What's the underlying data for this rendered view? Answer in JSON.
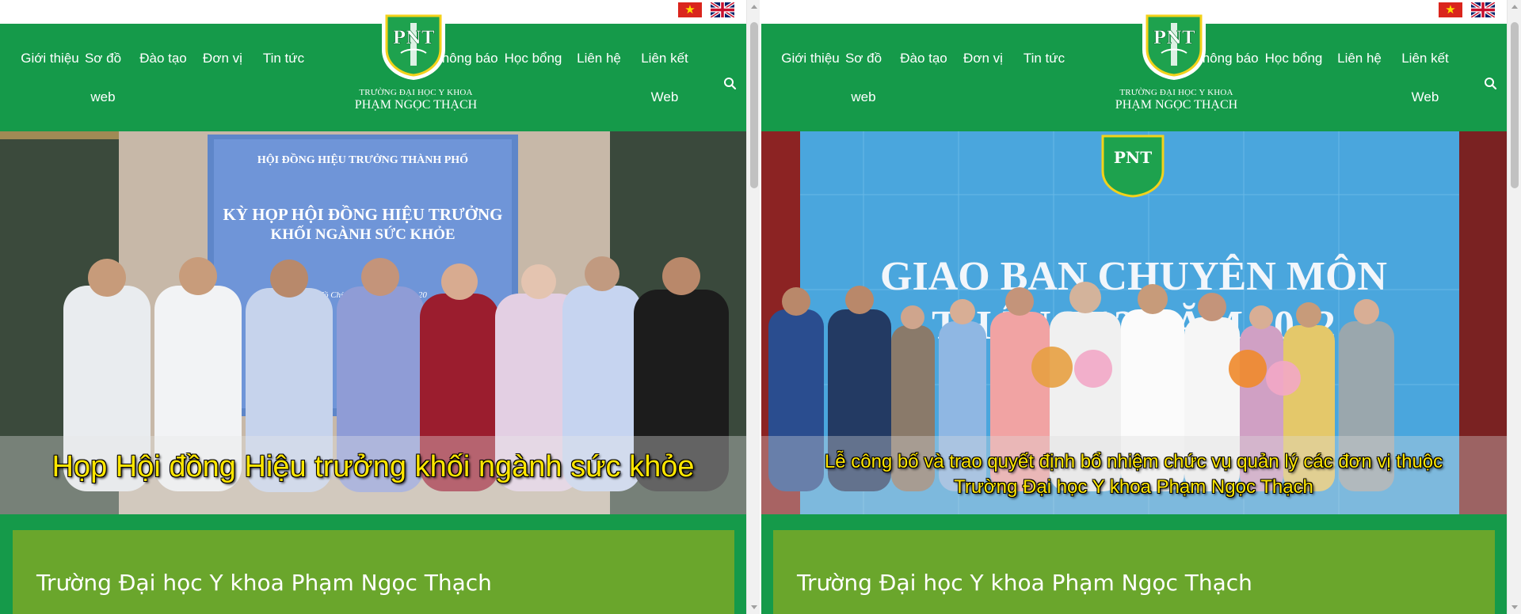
{
  "windows": [
    {
      "nav": {
        "items": [
          {
            "line1": "Giới thiệu",
            "line2": ""
          },
          {
            "line1": "Sơ đồ",
            "line2": "web"
          },
          {
            "line1": "Đào tạo",
            "line2": ""
          },
          {
            "line1": "Đơn vị",
            "line2": ""
          },
          {
            "line1": "Tin tức",
            "line2": ""
          },
          {
            "line1": "Thông báo",
            "line2": ""
          },
          {
            "line1": "Học bổng",
            "line2": ""
          },
          {
            "line1": "Liên hệ",
            "line2": ""
          },
          {
            "line1": "Liên kết",
            "line2": "Web"
          }
        ]
      },
      "logo": {
        "monogram": "PNT",
        "line1": "TRƯỜNG ĐẠI HỌC Y KHOA",
        "line2": "PHẠM NGỌC THẠCH"
      },
      "slide": {
        "screen_title": "HỘI ĐỒNG HIỆU TRƯỞNG THÀNH PHỐ",
        "screen_heading_1": "KỲ HỌP HỘI ĐỒNG HIỆU TRƯỞNG",
        "screen_heading_2": "KHỐI NGÀNH SỨC KHỎE",
        "screen_footer": "Hồ Chí Minh, tháng 12 năm 20",
        "caption_line1": "Họp Hội đồng Hiệu trưởng khối ngành sức khỏe",
        "caption_line2": ""
      },
      "info_title": "Trường Đại học Y khoa Phạm Ngọc Thạch"
    },
    {
      "nav": {
        "items": [
          {
            "line1": "Giới thiệu",
            "line2": ""
          },
          {
            "line1": "Sơ đồ",
            "line2": "web"
          },
          {
            "line1": "Đào tạo",
            "line2": ""
          },
          {
            "line1": "Đơn vị",
            "line2": ""
          },
          {
            "line1": "Tin tức",
            "line2": ""
          },
          {
            "line1": "Thông báo",
            "line2": ""
          },
          {
            "line1": "Học bổng",
            "line2": ""
          },
          {
            "line1": "Liên hệ",
            "line2": ""
          },
          {
            "line1": "Liên kết",
            "line2": "Web"
          }
        ]
      },
      "logo": {
        "monogram": "PNT",
        "line1": "TRƯỜNG ĐẠI HỌC Y KHOA",
        "line2": "PHẠM NGỌC THẠCH"
      },
      "slide": {
        "screen_title": "",
        "screen_heading_1": "GIAO BAN CHUYÊN MÔN",
        "screen_heading_2": "THÁNG 12 NĂM 2022",
        "screen_footer": "",
        "caption_line1": "Lễ công bố và trao quyết định bổ nhiệm chức vụ quản lý các đơn vị thuộc",
        "caption_line2": "Trường Đại học Y khoa Phạm Ngọc Thạch"
      },
      "info_title": "Trường Đại học Y khoa Phạm Ngọc Thạch"
    }
  ],
  "colors": {
    "header_green": "#159a4a",
    "card_green": "#6aa62c",
    "caption_yellow": "#ffe600",
    "vn_flag_red": "#da251d",
    "vn_flag_star": "#ffde00",
    "uk_flag_blue": "#012169"
  },
  "icons": {
    "language_vi": "vietnam-flag-icon",
    "language_en": "uk-flag-icon",
    "search": "search-icon",
    "scroll_up": "scroll-up-arrow-icon",
    "scroll_down": "scroll-down-arrow-icon"
  }
}
